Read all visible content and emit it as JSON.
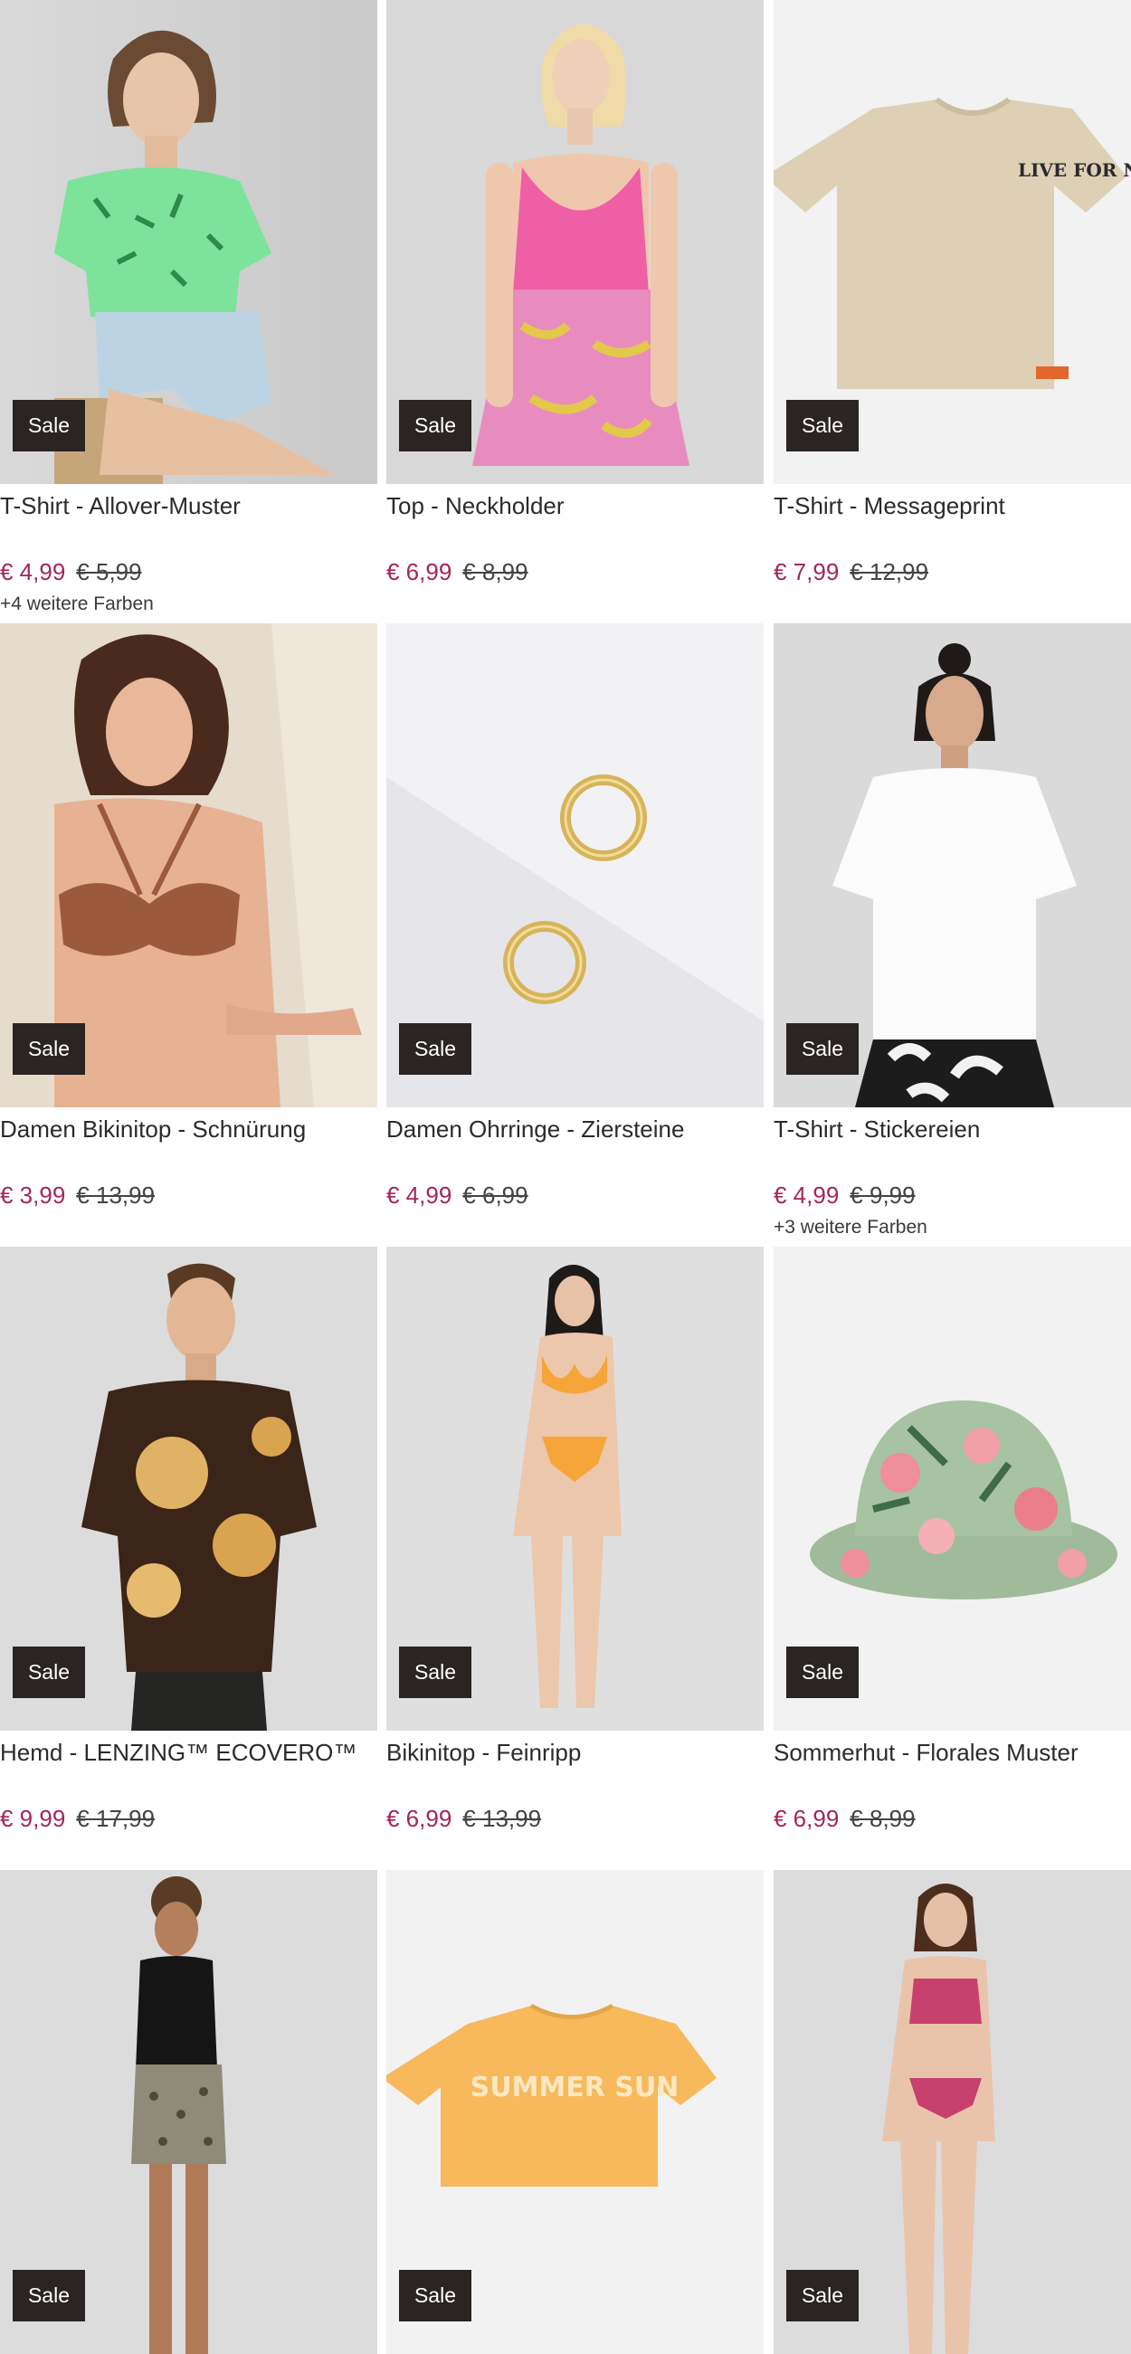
{
  "products": [
    {
      "title": "T-Shirt - Allover-Muster",
      "price": "€ 4,99",
      "old_price": "€ 5,99",
      "badge": "Sale",
      "colors_note": "+4 weitere Farben"
    },
    {
      "title": "Top - Neckholder",
      "price": "€ 6,99",
      "old_price": "€ 8,99",
      "badge": "Sale",
      "colors_note": ""
    },
    {
      "title": "T-Shirt - Messageprint",
      "price": "€ 7,99",
      "old_price": "€ 12,99",
      "badge": "Sale",
      "colors_note": "",
      "print_text": "LIVE FOR NOW MMXXII"
    },
    {
      "title": "Damen Bikinitop - Schnürung",
      "price": "€ 3,99",
      "old_price": "€ 13,99",
      "badge": "Sale",
      "colors_note": ""
    },
    {
      "title": "Damen Ohrringe - Ziersteine",
      "price": "€ 4,99",
      "old_price": "€ 6,99",
      "badge": "Sale",
      "colors_note": ""
    },
    {
      "title": "T-Shirt - Stickereien",
      "price": "€ 4,99",
      "old_price": "€ 9,99",
      "badge": "Sale",
      "colors_note": "+3 weitere Farben"
    },
    {
      "title": "Hemd - LENZING™ ECOVERO™",
      "price": "€ 9,99",
      "old_price": "€ 17,99",
      "badge": "Sale",
      "colors_note": ""
    },
    {
      "title": "Bikinitop - Feinripp",
      "price": "€ 6,99",
      "old_price": "€ 13,99",
      "badge": "Sale",
      "colors_note": ""
    },
    {
      "title": "Sommerhut - Florales Muster",
      "price": "€ 6,99",
      "old_price": "€ 8,99",
      "badge": "Sale",
      "colors_note": ""
    },
    {
      "title": "",
      "price": "",
      "old_price": "",
      "badge": "Sale",
      "colors_note": ""
    },
    {
      "title": "",
      "price": "",
      "old_price": "",
      "badge": "Sale",
      "colors_note": "",
      "print_text": "SUMMER SUN"
    },
    {
      "title": "",
      "price": "",
      "old_price": "",
      "badge": "Sale",
      "colors_note": ""
    }
  ],
  "colors": {
    "sale_price": "#a3265a",
    "badge_bg": "#2a2422",
    "badge_text": "#ffffff"
  }
}
